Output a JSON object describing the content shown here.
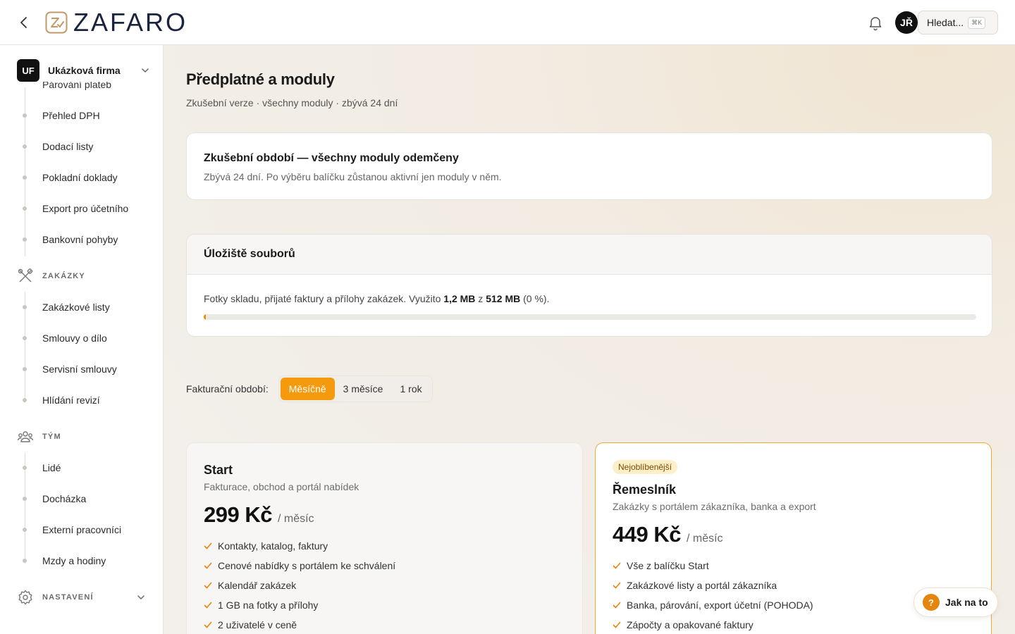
{
  "header": {
    "logo_text": "ZAFARO",
    "avatar": "JŘ",
    "search_label": "Hledat...",
    "search_shortcut": "⌘K"
  },
  "sidebar": {
    "company_badge": "UF",
    "company_name": "Ukázková firma",
    "clipped_item": "Párování plateb",
    "group1": [
      "Přehled DPH",
      "Dodací listy",
      "Pokladní doklady",
      "Export pro účetního",
      "Bankovní pohyby"
    ],
    "zakazky": {
      "label": "ZAKÁZKY",
      "items": [
        "Zakázkové listy",
        "Smlouvy o dílo",
        "Servisní smlouvy",
        "Hlídání revizí"
      ]
    },
    "tym": {
      "label": "TÝM",
      "items": [
        "Lidé",
        "Docházka",
        "Externí pracovníci",
        "Mzdy a hodiny"
      ]
    },
    "nastaveni": {
      "label": "NASTAVENÍ"
    }
  },
  "main": {
    "title": "Předplatné a moduly",
    "subtitle": "Zkušební verze · všechny moduly · zbývá 24 dní",
    "trial": {
      "title": "Zkušební období — všechny moduly odemčeny",
      "text": "Zbývá 24 dní. Po výběru balíčku zůstanou aktivní jen moduly v něm."
    },
    "storage": {
      "title": "Úložiště souborů",
      "text_before": "Fotky skladu, přijaté faktury a přílohy zakázek. Využito ",
      "used": "1,2 MB",
      "text_mid": " z ",
      "total": "512 MB",
      "text_after": " (0 %).",
      "usage_fraction": 0.0023
    },
    "billing": {
      "label": "Fakturační období:",
      "options": [
        "Měsíčně",
        "3 měsíce",
        "1 rok"
      ],
      "selected": "Měsíčně"
    },
    "plans": [
      {
        "name": "Start",
        "description": "Fakturace, obchod a portál nabídek",
        "price": "299 Kč",
        "period": "/ měsíc",
        "features": [
          "Kontakty, katalog, faktury",
          "Cenové nabídky s portálem ke schválení",
          "Kalendář zakázek",
          "1 GB na fotky a přílohy",
          "2 uživatelé v ceně"
        ]
      },
      {
        "badge": "Nejoblíbenější",
        "name": "Řemeslník",
        "description": "Zakázky s portálem zákazníka, banka a export",
        "price": "449 Kč",
        "period": "/ měsíc",
        "features": [
          "Vše z balíčku Start",
          "Zakázkové listy a portál zákazníka",
          "Banka, párování, export účetní (POHODA)",
          "Zápočty a opakované faktury"
        ]
      }
    ]
  },
  "help": {
    "icon": "?",
    "label": "Jak na to"
  },
  "colors": {
    "accent": "#f59a0c",
    "dark": "#111111",
    "brand_navy": "#1a2440"
  },
  "icons": [
    "back-chevron-icon",
    "zafaro-logo-mark",
    "bell-icon",
    "tools-icon",
    "team-icon",
    "gear-icon",
    "check-icon",
    "chevron-down-icon"
  ]
}
